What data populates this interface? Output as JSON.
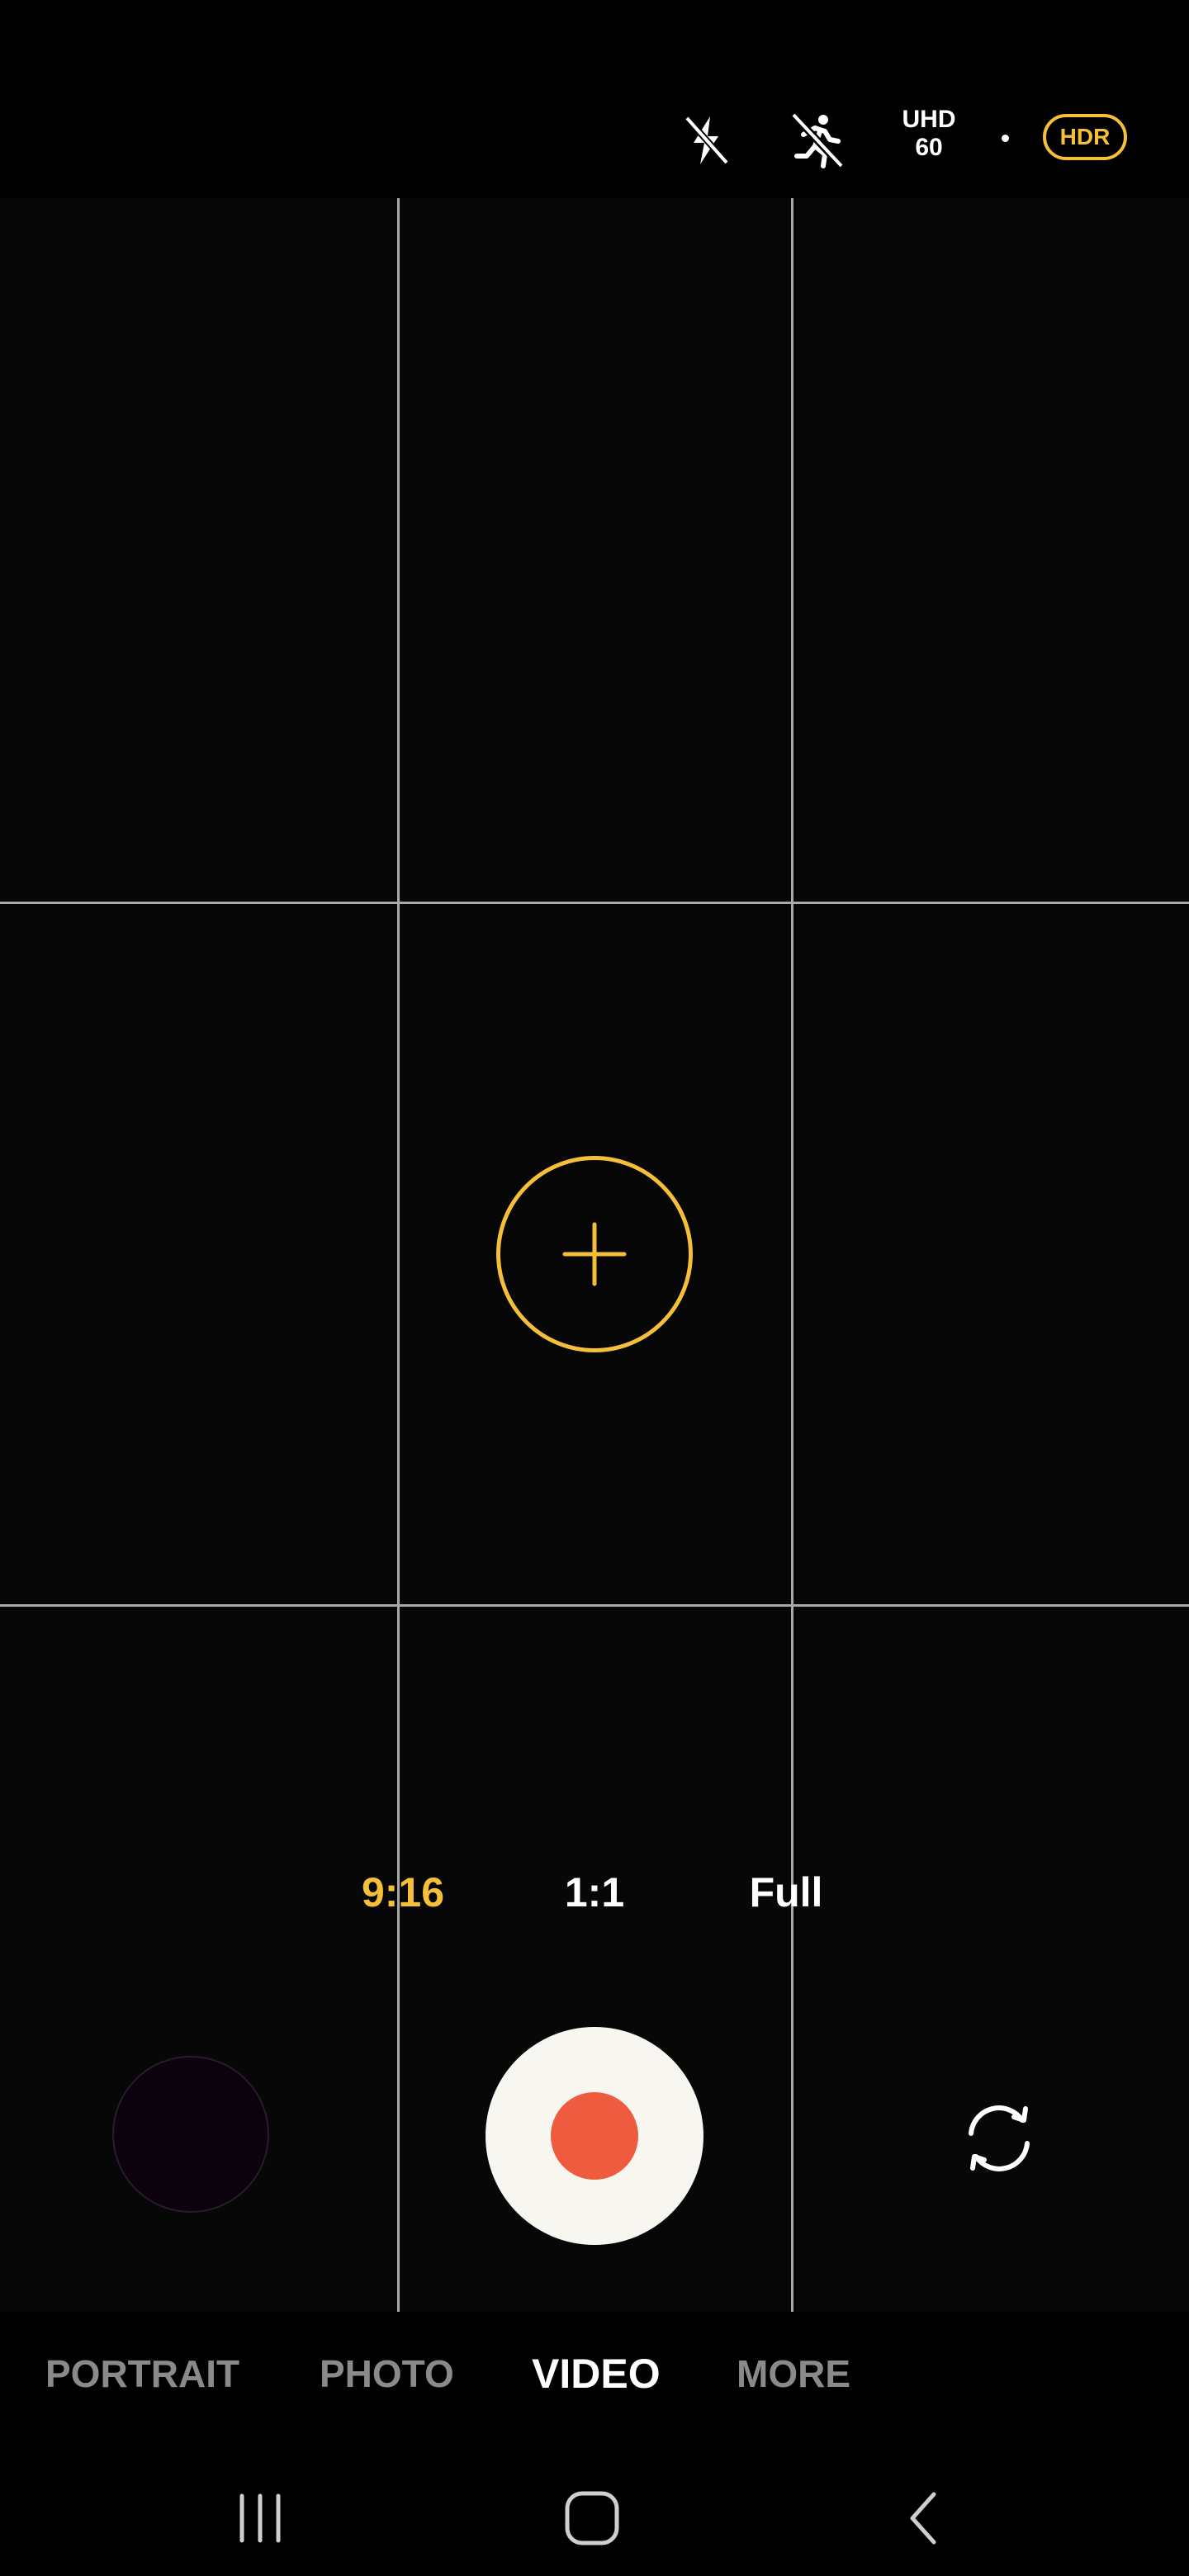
{
  "status_bar": {
    "flash_icon": "flash-off-icon",
    "motion_icon": "motion-off-icon",
    "resolution_line1": "UHD",
    "resolution_line2": "60",
    "hdr_label": "HDR"
  },
  "viewfinder": {
    "grid": "3x3",
    "focus_icon": "plus-icon"
  },
  "aspect_ratios": [
    {
      "label": "9:16",
      "selected": true
    },
    {
      "label": "1:1",
      "selected": false
    },
    {
      "label": "Full",
      "selected": false
    }
  ],
  "controls": {
    "gallery_icon": "gallery-thumbnail",
    "record_icon": "record-icon",
    "switch_camera_icon": "camera-switch-icon"
  },
  "modes": [
    {
      "label": "PORTRAIT",
      "selected": false
    },
    {
      "label": "PHOTO",
      "selected": false
    },
    {
      "label": "VIDEO",
      "selected": true
    },
    {
      "label": "MORE",
      "selected": false
    }
  ],
  "navigation": {
    "recents_icon": "recents-icon",
    "home_icon": "home-icon",
    "back_icon": "back-icon"
  },
  "colors": {
    "accent": "#f6bf3a",
    "record": "#ef5b3f",
    "inactive_mode": "#8a8a8a"
  }
}
